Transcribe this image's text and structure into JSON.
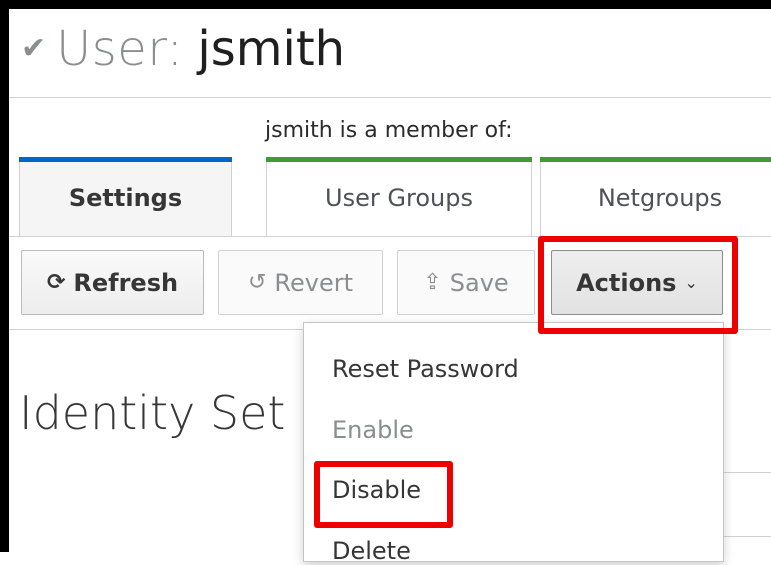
{
  "header": {
    "label": "User:",
    "username": "jsmith",
    "check_icon": "checkmark-icon"
  },
  "member_of_text": "jsmith is a member of:",
  "tabs": [
    {
      "label": "Settings",
      "active": true,
      "accent": "#0066cc"
    },
    {
      "label": "User Groups",
      "active": false,
      "accent": "#3f9c35"
    },
    {
      "label": "Netgroups",
      "active": false,
      "accent": "#3f9c35"
    }
  ],
  "toolbar": {
    "refresh_label": "Refresh",
    "revert_label": "Revert",
    "save_label": "Save",
    "actions_label": "Actions"
  },
  "section_title": "Identity Set",
  "actions_menu": {
    "items": [
      "Reset Password",
      "Enable",
      "Disable",
      "Delete"
    ]
  },
  "highlight_color": "#ee0000"
}
